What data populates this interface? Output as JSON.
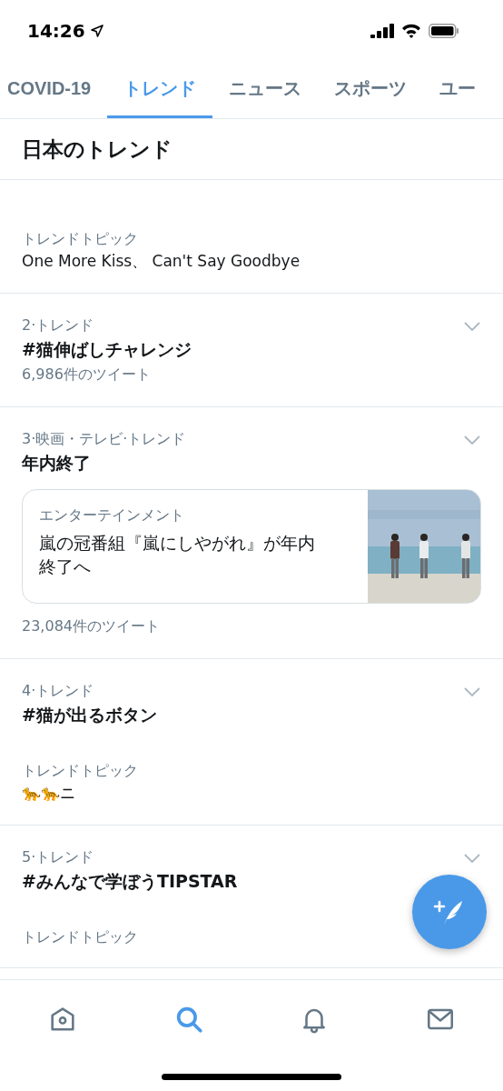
{
  "status_bar": {
    "time": "14:26"
  },
  "tabs": [
    {
      "label": "COVID-19",
      "selected": false
    },
    {
      "label": "トレンド",
      "selected": true
    },
    {
      "label": "ニュース",
      "selected": false
    },
    {
      "label": "スポーツ",
      "selected": false
    },
    {
      "label": "ユー",
      "selected": false
    }
  ],
  "section_title": "日本のトレンド",
  "trends": [
    {
      "topic_label": "トレンドトピック",
      "topic": "One More Kiss、 Can't Say Goodbye"
    },
    {
      "meta": "2·トレンド",
      "title": "#猫伸ばしチャレンジ",
      "count": "6,986件のツイート"
    },
    {
      "meta": "3·映画・テレビ·トレンド",
      "title": "年内終了",
      "card": {
        "category": "エンターテインメント",
        "headline": "嵐の冠番組『嵐にしやがれ』が年内終了へ",
        "kind": "picture"
      },
      "count": "23,084件のツイート"
    },
    {
      "meta": "4·トレンド",
      "title": "#猫が出るボタン",
      "topic_label": "トレンドトピック",
      "topic": "🐆🐆ニ"
    },
    {
      "meta": "5·トレンド",
      "title": "#みんなで学ぼうTIPSTAR",
      "topic_label": "トレンドトピック"
    }
  ],
  "bottom_nav": [
    {
      "kind": "home",
      "selected": false
    },
    {
      "kind": "search",
      "selected": true
    },
    {
      "kind": "bell",
      "selected": false
    },
    {
      "kind": "mail",
      "selected": false
    }
  ]
}
